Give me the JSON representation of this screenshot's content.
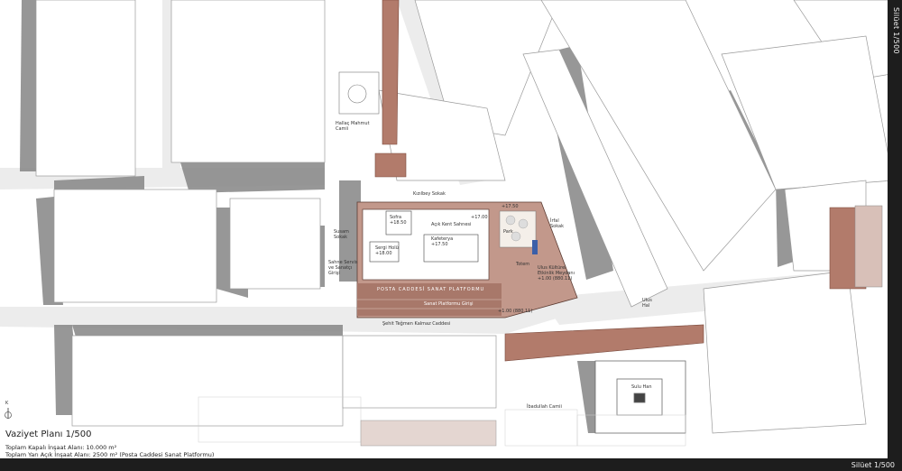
{
  "plan": {
    "title": "Vaziyet Planı 1/500",
    "stats": [
      "Toplam Kapalı İnşaat Alanı: 10.000 m²",
      "Toplam Yarı Açık İnşaat Alanı: 2500 m² (Posta Caddesi Sanat Platformu)"
    ],
    "north_label": "K"
  },
  "silhouette": {
    "vertical": "Silüet 1/500",
    "horizontal": "Silüet 1/500"
  },
  "labels": {
    "hallac": "Hallaç Mahmut Camii",
    "kizilbey": "Kızılbey Sokak",
    "susam": "Susam Sokak",
    "sahne": "Sahne Servis ve Sanatçı Girişi",
    "sofra": "Sofra +18.50",
    "acik_kent": "Açık Kent Sahnesi",
    "kafeterya": "Kafeterya +17.50",
    "sergi": "Sergi Holü +18.00",
    "park": "Park",
    "irfal": "İrfal Sokak",
    "totem": "Totem",
    "ulus_meydan": "Ulus Kültürel Etkinlik Meydanı +1.00 (880.11)",
    "posta_platform": "POSTA CADDESİ SANAT PLATFORMU",
    "posta_sub": "Sanat Platformu Girişi",
    "level_top": "+17.50",
    "level_mid": "+17.00",
    "level_bottom": "+1.00 (880.11)",
    "sehit": "Şehit Teğmen Kalmaz Caddesi",
    "ulus_hal": "Ulus Hal",
    "suluhan": "Sulu Han",
    "ibadullah": "İbadullah Camii"
  }
}
